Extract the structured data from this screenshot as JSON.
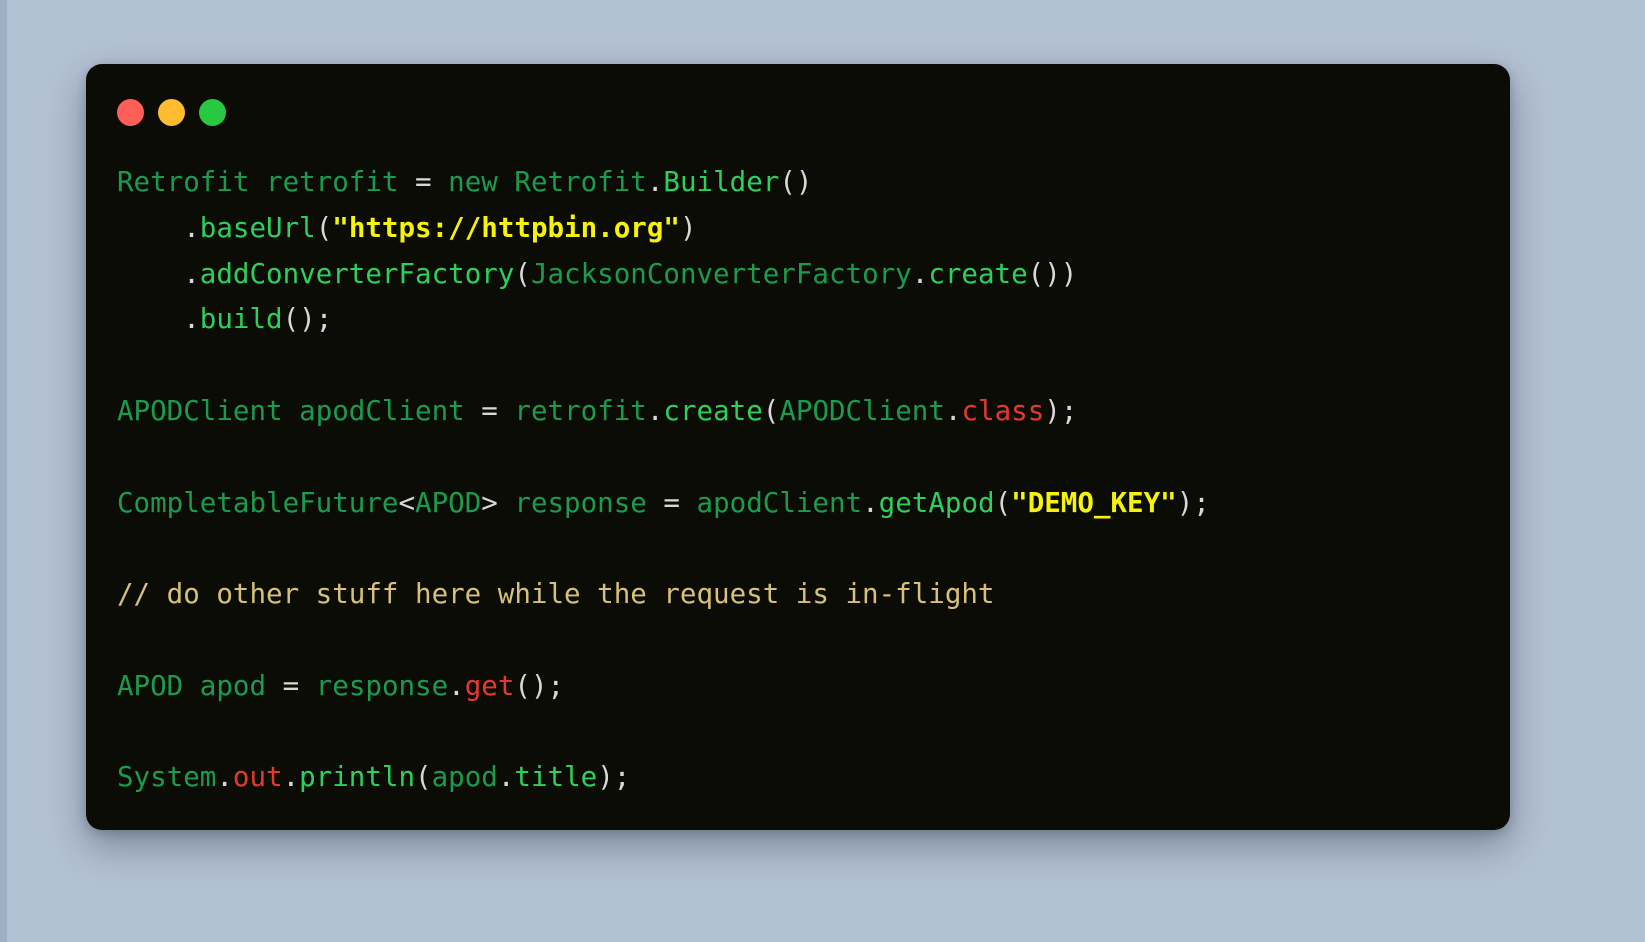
{
  "window": {
    "background_color": "#b2c1d3",
    "card_background_color": "#0c0c06",
    "traffic_lights": [
      {
        "name": "close",
        "label": "Close",
        "color": "#fe5f57"
      },
      {
        "name": "minimize",
        "label": "Minimize",
        "color": "#febc2e"
      },
      {
        "name": "maximize",
        "label": "Maximize",
        "color": "#28c840"
      }
    ]
  },
  "syntax_colors": {
    "type": "#1a9b4d",
    "method": "#2ed05c",
    "punctuation": "#d8d8d8",
    "string": "#f5f30a",
    "keyword": "#e33a2e",
    "comment": "#d6c177"
  },
  "code": {
    "language": "java",
    "plain_text": "Retrofit retrofit = new Retrofit.Builder()\n    .baseUrl(\"https://httpbin.org\")\n    .addConverterFactory(JacksonConverterFactory.create())\n    .build();\n\nAPODClient apodClient = retrofit.create(APODClient.class);\n\nCompletableFuture<APOD> response = apodClient.getApod(\"DEMO_KEY\");\n\n// do other stuff here while the request is in-flight\n\nAPOD apod = response.get();\n\nSystem.out.println(apod.title);",
    "lines": [
      {
        "n": 1,
        "tokens": [
          {
            "t": "Retrofit",
            "c": "type"
          },
          {
            "t": " ",
            "c": "plain"
          },
          {
            "t": "retrofit",
            "c": "ident"
          },
          {
            "t": " ",
            "c": "plain"
          },
          {
            "t": "=",
            "c": "punc"
          },
          {
            "t": " ",
            "c": "plain"
          },
          {
            "t": "new",
            "c": "type"
          },
          {
            "t": " ",
            "c": "plain"
          },
          {
            "t": "Retrofit",
            "c": "type"
          },
          {
            "t": ".",
            "c": "punc"
          },
          {
            "t": "Builder",
            "c": "method"
          },
          {
            "t": "()",
            "c": "punc"
          }
        ]
      },
      {
        "n": 2,
        "tokens": [
          {
            "t": "    ",
            "c": "plain"
          },
          {
            "t": ".",
            "c": "punc"
          },
          {
            "t": "baseUrl",
            "c": "method"
          },
          {
            "t": "(",
            "c": "punc"
          },
          {
            "t": "\"https://httpbin.org\"",
            "c": "str"
          },
          {
            "t": ")",
            "c": "punc"
          }
        ]
      },
      {
        "n": 3,
        "tokens": [
          {
            "t": "    ",
            "c": "plain"
          },
          {
            "t": ".",
            "c": "punc"
          },
          {
            "t": "addConverterFactory",
            "c": "method"
          },
          {
            "t": "(",
            "c": "punc"
          },
          {
            "t": "JacksonConverterFactory",
            "c": "type"
          },
          {
            "t": ".",
            "c": "punc"
          },
          {
            "t": "create",
            "c": "method"
          },
          {
            "t": "())",
            "c": "punc"
          }
        ]
      },
      {
        "n": 4,
        "tokens": [
          {
            "t": "    ",
            "c": "plain"
          },
          {
            "t": ".",
            "c": "punc"
          },
          {
            "t": "build",
            "c": "method"
          },
          {
            "t": "();",
            "c": "punc"
          }
        ]
      },
      {
        "n": 5,
        "tokens": []
      },
      {
        "n": 6,
        "tokens": [
          {
            "t": "APODClient",
            "c": "type"
          },
          {
            "t": " ",
            "c": "plain"
          },
          {
            "t": "apodClient",
            "c": "ident"
          },
          {
            "t": " ",
            "c": "plain"
          },
          {
            "t": "=",
            "c": "punc"
          },
          {
            "t": " ",
            "c": "plain"
          },
          {
            "t": "retrofit",
            "c": "ident"
          },
          {
            "t": ".",
            "c": "punc"
          },
          {
            "t": "create",
            "c": "method"
          },
          {
            "t": "(",
            "c": "punc"
          },
          {
            "t": "APODClient",
            "c": "type"
          },
          {
            "t": ".",
            "c": "punc"
          },
          {
            "t": "class",
            "c": "key"
          },
          {
            "t": ");",
            "c": "punc"
          }
        ]
      },
      {
        "n": 7,
        "tokens": []
      },
      {
        "n": 8,
        "tokens": [
          {
            "t": "CompletableFuture",
            "c": "type"
          },
          {
            "t": "<",
            "c": "punc"
          },
          {
            "t": "APOD",
            "c": "type"
          },
          {
            "t": ">",
            "c": "punc"
          },
          {
            "t": " ",
            "c": "plain"
          },
          {
            "t": "response",
            "c": "ident"
          },
          {
            "t": " ",
            "c": "plain"
          },
          {
            "t": "=",
            "c": "punc"
          },
          {
            "t": " ",
            "c": "plain"
          },
          {
            "t": "apodClient",
            "c": "ident"
          },
          {
            "t": ".",
            "c": "punc"
          },
          {
            "t": "getApod",
            "c": "method"
          },
          {
            "t": "(",
            "c": "punc"
          },
          {
            "t": "\"DEMO_KEY\"",
            "c": "str"
          },
          {
            "t": ");",
            "c": "punc"
          }
        ]
      },
      {
        "n": 9,
        "tokens": []
      },
      {
        "n": 10,
        "tokens": [
          {
            "t": "// do other stuff here while the request is in-flight",
            "c": "cmt"
          }
        ]
      },
      {
        "n": 11,
        "tokens": []
      },
      {
        "n": 12,
        "tokens": [
          {
            "t": "APOD",
            "c": "type"
          },
          {
            "t": " ",
            "c": "plain"
          },
          {
            "t": "apod",
            "c": "ident"
          },
          {
            "t": " ",
            "c": "plain"
          },
          {
            "t": "=",
            "c": "punc"
          },
          {
            "t": " ",
            "c": "plain"
          },
          {
            "t": "response",
            "c": "ident"
          },
          {
            "t": ".",
            "c": "punc"
          },
          {
            "t": "get",
            "c": "key"
          },
          {
            "t": "();",
            "c": "punc"
          }
        ]
      },
      {
        "n": 13,
        "tokens": []
      },
      {
        "n": 14,
        "tokens": [
          {
            "t": "System",
            "c": "type"
          },
          {
            "t": ".",
            "c": "punc"
          },
          {
            "t": "out",
            "c": "key"
          },
          {
            "t": ".",
            "c": "punc"
          },
          {
            "t": "println",
            "c": "method"
          },
          {
            "t": "(",
            "c": "punc"
          },
          {
            "t": "apod",
            "c": "ident"
          },
          {
            "t": ".",
            "c": "punc"
          },
          {
            "t": "title",
            "c": "method"
          },
          {
            "t": ");",
            "c": "punc"
          }
        ]
      }
    ]
  }
}
